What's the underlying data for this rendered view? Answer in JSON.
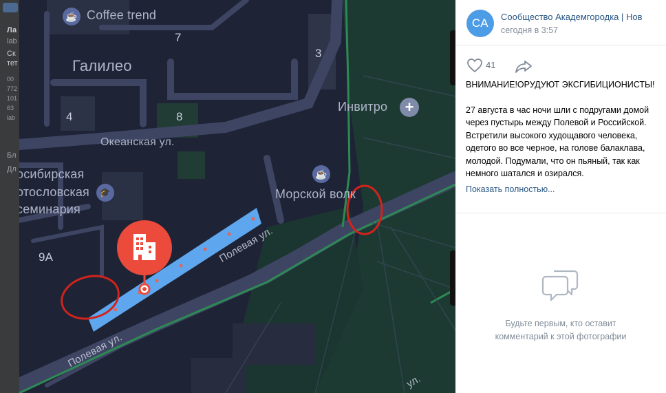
{
  "backdrop": {
    "lines": [
      "Ла",
      "lab",
      "Ск",
      "тет",
      "00",
      "772",
      "101",
      "63",
      "lab",
      "Бл",
      "Дл"
    ]
  },
  "map": {
    "places": {
      "coffee_trend": "Coffee trend",
      "galileo": "Галилео",
      "invitro": "Инвитро",
      "okeanskaya": "Океанская ул.",
      "seminary_1": "осибирская",
      "seminary_2": "отословская",
      "seminary_3": "семинария",
      "morskoy_volk": "Морской волк",
      "polevaya_1": "Полевая ул.",
      "polevaya_2": "Полевая ул.",
      "street_edge": "ул."
    },
    "house_numbers": {
      "n7": "7",
      "n3": "3",
      "n4": "4",
      "n8": "8",
      "n9a": "9А"
    },
    "icons": {
      "cafe": "cup-icon",
      "medical": "plus-icon",
      "education": "graduation-cap-icon",
      "building": "building-icon"
    }
  },
  "post": {
    "avatar_initials": "СА",
    "group_name": "Сообщество Академгородка | Нов",
    "time": "сегодня в 3:57",
    "likes": "41",
    "title": "ВНИМАНИЕ!ОРУДУЮТ ЭКСГИБИЦИОНИСТЫ!",
    "text": "27 августа в час ночи шли с подругами домой через пустырь между Полевой и Российской. Встретили высокого худощавого человека, одетого во все черное, на голове балаклава, молодой. Подумали, что он пьяный, так как немного шатался и озирался.",
    "show_more": "Показать полностью..."
  },
  "comments": {
    "empty_line1": "Будьте первым, кто оставит",
    "empty_line2": "комментарий к этой фотографии"
  },
  "colors": {
    "accent": "#2a5885",
    "avatar": "#4d9ce6",
    "map_bg": "#1e2336",
    "road_highlight": "#5ea6ee",
    "marker": "#ec4b3c",
    "circle_annotation": "#d2231c"
  }
}
